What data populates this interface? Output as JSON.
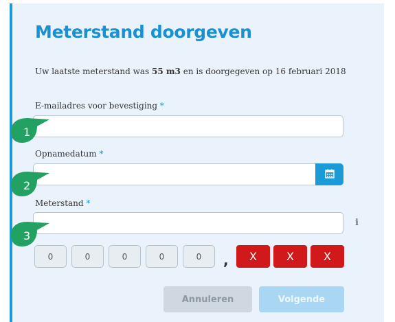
{
  "form": {
    "title": "Meterstand doorgeven",
    "intro_prefix": "Uw laatste meterstand was ",
    "intro_value": "55 m3",
    "intro_suffix": " en is doorgegeven op 16 februari 2018",
    "email_label": "E-mailadres voor bevestiging",
    "date_label": "Opnamedatum",
    "meter_label": "Meterstand",
    "required_mark": "*",
    "email_value": "",
    "date_value": "",
    "meter_value": "",
    "info_icon": "i",
    "digits": [
      "0",
      "0",
      "0",
      "0",
      "0"
    ],
    "decimal_separator": ",",
    "decimal_digits": [
      "X",
      "X",
      "X"
    ],
    "cancel_label": "Annuleren",
    "next_label": "Volgende"
  },
  "markers": [
    "1",
    "2",
    "3"
  ],
  "colors": {
    "accent": "#1a9ad6",
    "title": "#1a8fd2",
    "panel_bg": "#eaf3fc",
    "marker": "#23a163",
    "error": "#d1181b"
  }
}
